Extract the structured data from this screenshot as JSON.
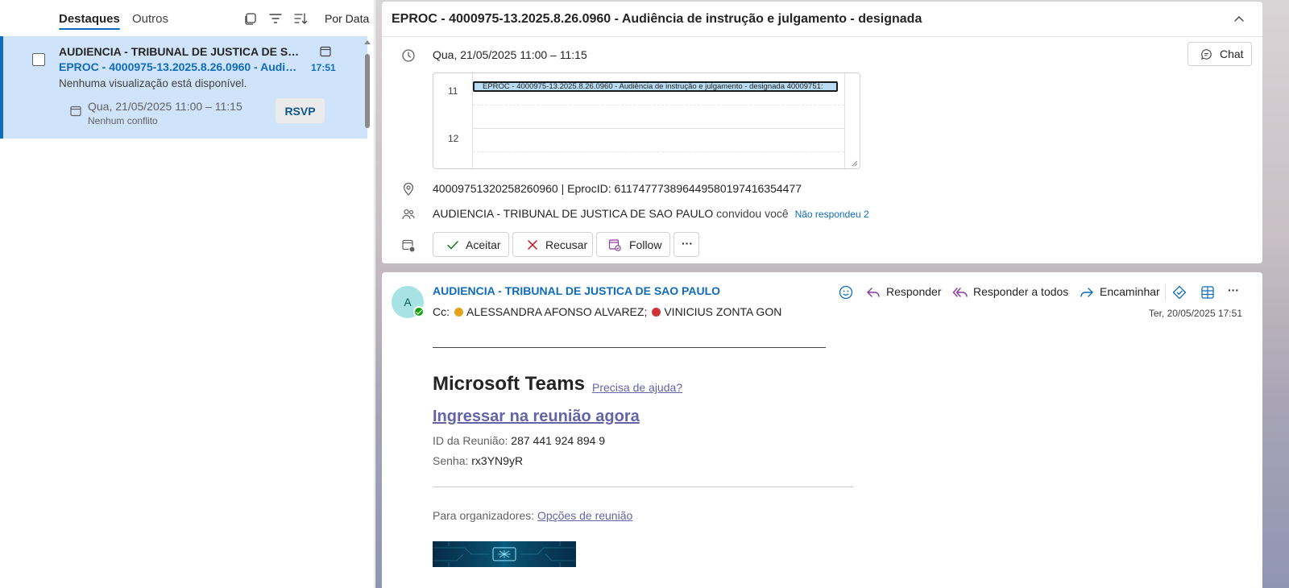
{
  "list": {
    "tabs": {
      "focused": "Destaques",
      "other": "Outros"
    },
    "sort_label": "Por Data",
    "item": {
      "sender": "AUDIENCIA - TRIBUNAL DE JUSTICA DE SAO ...",
      "subject": "EPROC - 4000975-13.2025.8.26.0960 - Audiê...",
      "time": "17:51",
      "preview": "Nenhuma visualização está disponível.",
      "event_date": "Qua, 21/05/2025 11:00 – 11:15",
      "event_conflict": "Nenhum conflito",
      "rsvp_label": "RSVP"
    }
  },
  "event": {
    "title": "EPROC - 4000975-13.2025.8.26.0960 - Audiência de instrução e julgamento - designada",
    "datetime": "Qua, 21/05/2025 11:00 – 11:15",
    "chat_label": "Chat",
    "calendar": {
      "hour_11": "11",
      "hour_12": "12",
      "event_text": "EPROC - 4000975-13.2025.8.26.0960 - Audiência de instrução e julgamento - designada 40009751:"
    },
    "location": "40009751320258260960 | EprocID: 611747773896449580197416354477",
    "organizer": "AUDIENCIA - TRIBUNAL DE JUSTICA DE SAO PAULO",
    "invited_text": "convidou você",
    "no_response": "Não respondeu 2",
    "actions": {
      "accept": "Aceitar",
      "decline": "Recusar",
      "follow": "Follow",
      "more": "···"
    }
  },
  "message": {
    "avatar_initial": "A",
    "sender": "AUDIENCIA - TRIBUNAL DE JUSTICA DE SAO PAULO",
    "cc_label": "Cc:",
    "cc": [
      "ALESSANDRA AFONSO ALVAREZ;",
      "VINICIUS ZONTA GON"
    ],
    "date": "Ter, 20/05/2025 17:51",
    "toolbar": {
      "reply": "Responder",
      "reply_all": "Responder a todos",
      "forward": "Encaminhar",
      "more": "···"
    },
    "body": {
      "teams_title": "Microsoft Teams",
      "help_link": "Precisa de ajuda?",
      "join_link": "Ingressar na reunião agora",
      "meeting_id_label": "ID da Reunião:",
      "meeting_id": "287 441 924 894 9",
      "password_label": "Senha:",
      "password": "rx3YN9yR",
      "organizers_label": "Para organizadores:",
      "options_link": "Opções de reunião"
    }
  },
  "colors": {
    "accent": "#0f6cbd",
    "selected_item_bg": "#cfe4fa",
    "teams_link": "#6264a7",
    "presence_available": "#13a10e",
    "presence_away": "#e3a21a",
    "presence_busy": "#d13438"
  },
  "icons": [
    "select-mode-icon",
    "filter-icon",
    "sort-icon",
    "checkbox-icon",
    "calendar-icon",
    "clock-icon",
    "chat-icon",
    "location-icon",
    "people-icon",
    "calendar-status-icon",
    "checkmark-icon",
    "close-icon",
    "follow-icon",
    "emoji-icon",
    "reply-icon",
    "reply-all-icon",
    "forward-icon",
    "immersive-reader-icon",
    "view-icon",
    "chevron-up-icon"
  ]
}
